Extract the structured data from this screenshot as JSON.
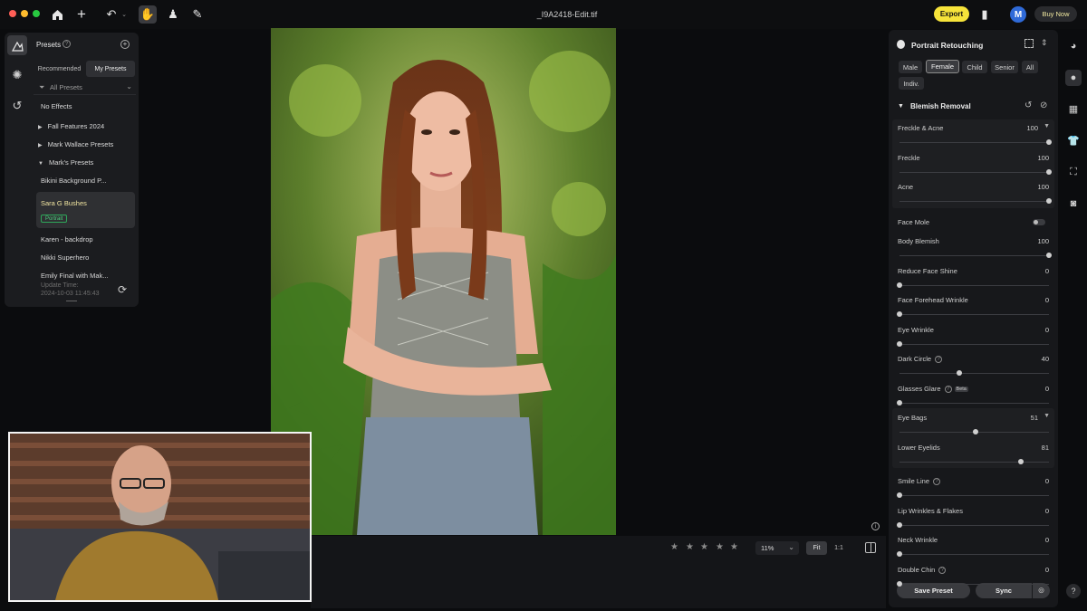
{
  "titlebar": {
    "doc_title": "_I9A2418-Edit.tif",
    "export_label": "Export",
    "avatar_letter": "M",
    "buy_label": "Buy Now"
  },
  "presets": {
    "title": "Presets",
    "help": "?",
    "add": "+",
    "tabs": [
      "Recommended",
      "My Presets"
    ],
    "filter_label": "All Presets",
    "no_effects": "No Effects",
    "folders": [
      "Fall Features 2024",
      "Mark Wallace Presets",
      "Mark's Presets"
    ],
    "items": [
      "Bikini Background P...",
      "Sara G Bushes",
      "Karen - backdrop",
      "Nikki Superhero",
      "Emily Final with Mak..."
    ],
    "selected_tag": "Portrait",
    "update_time_label": "Update Time:",
    "update_time_value": "2024-10-03 11:45:43"
  },
  "bottom": {
    "zoom": "11%",
    "fit": "Fit",
    "one_to_one": "1:1",
    "stars": [
      "★",
      "★",
      "★",
      "★",
      "★"
    ]
  },
  "retouch": {
    "title": "Portrait Retouching",
    "chips": [
      "Male",
      "Female",
      "Child",
      "Senior",
      "All",
      "Indiv."
    ],
    "selected_chip": "Female",
    "section_title": "Blemish Removal",
    "sliders": [
      {
        "label": "Freckle & Acne",
        "value": "100",
        "level": 1.0
      },
      {
        "label": "Freckle",
        "value": "100",
        "level": 1.0
      },
      {
        "label": "Acne",
        "value": "100",
        "level": 1.0
      },
      {
        "label": "Face Mole",
        "value": "",
        "level": null
      },
      {
        "label": "Body Blemish",
        "value": "100",
        "level": 1.0
      },
      {
        "label": "Reduce Face Shine",
        "value": "0",
        "level": 0.0
      },
      {
        "label": "Face Forehead Wrinkle",
        "value": "0",
        "level": 0.0
      },
      {
        "label": "Eye Wrinkle",
        "value": "0",
        "level": 0.0
      },
      {
        "label": "Dark Circle",
        "value": "40",
        "level": 0.4
      },
      {
        "label": "Glasses Glare",
        "value": "0",
        "level": 0.0
      },
      {
        "label": "Eye Bags",
        "value": "51",
        "level": 0.51
      },
      {
        "label": "Lower Eyelids",
        "value": "81",
        "level": 0.81
      },
      {
        "label": "Smile Line",
        "value": "0",
        "level": 0.0
      },
      {
        "label": "Lip Wrinkles & Flakes",
        "value": "0",
        "level": 0.0
      },
      {
        "label": "Neck Wrinkle",
        "value": "0",
        "level": 0.0
      },
      {
        "label": "Double Chin",
        "value": "0",
        "level": 0.0
      }
    ],
    "beta": "Beta",
    "save_preset": "Save Preset",
    "sync": "Sync"
  },
  "help_label": "?"
}
